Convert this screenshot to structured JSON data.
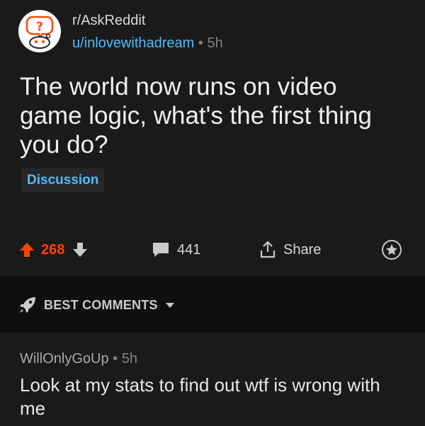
{
  "post": {
    "subreddit": "r/AskReddit",
    "author": "u/inlovewithadream",
    "separator": " • ",
    "age": "5h",
    "title": "The world now runs on video game logic, what's the first thing you do?",
    "flair": "Discussion",
    "votes": "268",
    "comment_count": "441",
    "share_label": "Share"
  },
  "sort": {
    "label": "BEST COMMENTS"
  },
  "comment": {
    "author": "WillOnlyGoUp",
    "separator": " • ",
    "age": "5h",
    "body": "Look at my stats to find out wtf is wrong with me"
  },
  "colors": {
    "background": "#1a1a1b",
    "sort_bar": "#0f0f10",
    "upvote": "#ff4500",
    "link": "#4fbcff",
    "muted": "#818384"
  },
  "icons": {
    "subreddit": "askreddit-snoo-icon",
    "upvote": "upvote-arrow-icon",
    "downvote": "downvote-arrow-icon",
    "comments": "comment-bubble-icon",
    "share": "share-icon",
    "award": "award-icon",
    "sort": "rocket-icon",
    "dropdown": "caret-down-icon"
  }
}
